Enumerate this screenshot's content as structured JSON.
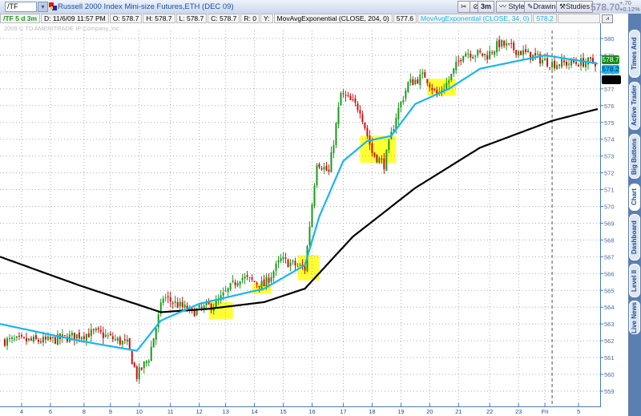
{
  "header": {
    "symbol": "/TF",
    "title": "Russell 2000 Index Mini-size Futures,ETH (DEC 09)",
    "last": "578.70",
    "change": "+.70",
    "change_pct": "+0.12%",
    "toolbar": {
      "aggregation": "3m",
      "style": "Style",
      "drawings": "Drawings",
      "studies": "Studies"
    }
  },
  "info_bar": {
    "symbol_period": "/TF 5 d 3m",
    "date": "D: 11/6/09 11:57 PM",
    "open": "O: 578.7",
    "high": "H: 578.7",
    "low": "L: 578.7",
    "close": "C: 578.7",
    "range": "R: 0",
    "y": "Y:",
    "study1": "MovAvgExponential (CLOSE, 204, 0)",
    "study1_val": "577.6",
    "study2": "MovAvgExponential (CLOSE, 34, 0)",
    "study2_val": "578.2"
  },
  "copyright": "2009 © TD AMERITRADE IP Company, Inc.",
  "price_tags": {
    "last": "578.7",
    "ema34": "578.2"
  },
  "colors": {
    "up": "#1a9a1a",
    "down": "#d01010",
    "ema34": "#19b5f0",
    "ema204": "#000000",
    "highlight": "#ffff33"
  },
  "side_tabs": [
    "Times And Sales",
    "Active Trader",
    "Big Buttons",
    "Chart",
    "Dashboard",
    "Level II",
    "Live News"
  ],
  "chart_data": {
    "type": "candlestick",
    "y_ticks": [
      559,
      560,
      561,
      562,
      563,
      564,
      565,
      566,
      567,
      568,
      569,
      570,
      571,
      572,
      573,
      574,
      575,
      576,
      577,
      578,
      579,
      580
    ],
    "ylim": [
      558.2,
      580.5
    ],
    "xlim": [
      0,
      250
    ],
    "x_ticks": [
      {
        "label": "4",
        "x": 9
      },
      {
        "label": "6",
        "x": 21
      },
      {
        "label": "8",
        "x": 35
      },
      {
        "label": "9",
        "x": 46
      },
      {
        "label": "10",
        "x": 58
      },
      {
        "label": "11",
        "x": 71
      },
      {
        "label": "12",
        "x": 83
      },
      {
        "label": "13",
        "x": 94
      },
      {
        "label": "14",
        "x": 106
      },
      {
        "label": "15",
        "x": 118
      },
      {
        "label": "16",
        "x": 130
      },
      {
        "label": "17",
        "x": 143
      },
      {
        "label": "18",
        "x": 155
      },
      {
        "label": "19",
        "x": 167
      },
      {
        "label": "20",
        "x": 179
      },
      {
        "label": "21",
        "x": 191
      },
      {
        "label": "22",
        "x": 204
      },
      {
        "label": "23",
        "x": 216
      },
      {
        "label": "Fri",
        "x": 227
      },
      {
        "label": "5",
        "x": 241
      }
    ],
    "session_break_x": 230,
    "price_path": [
      [
        2,
        562.0
      ],
      [
        20,
        562.0
      ],
      [
        40,
        562.5
      ],
      [
        53,
        561.8
      ],
      [
        57,
        559.9
      ],
      [
        62,
        561
      ],
      [
        68,
        564.6
      ],
      [
        80,
        563.7
      ],
      [
        90,
        564.2
      ],
      [
        100,
        565.8
      ],
      [
        110,
        565.3
      ],
      [
        117,
        566.8
      ],
      [
        127,
        566.3
      ],
      [
        129,
        568.9
      ],
      [
        132,
        572.7
      ],
      [
        137,
        572
      ],
      [
        142,
        576.7
      ],
      [
        150,
        575.8
      ],
      [
        155,
        573.2
      ],
      [
        160,
        572.5
      ],
      [
        165,
        575.4
      ],
      [
        170,
        577.3
      ],
      [
        177,
        577.8
      ],
      [
        182,
        576.6
      ],
      [
        187,
        577.5
      ],
      [
        193,
        579.2
      ],
      [
        203,
        579
      ],
      [
        208,
        579.7
      ],
      [
        217,
        579.2
      ],
      [
        230,
        578.5
      ],
      [
        248,
        578.6
      ]
    ],
    "ema34": [
      [
        0,
        563.0
      ],
      [
        33,
        562.0
      ],
      [
        57,
        561.4
      ],
      [
        67,
        563.2
      ],
      [
        83,
        564.2
      ],
      [
        110,
        565.1
      ],
      [
        127,
        566.5
      ],
      [
        133,
        569.4
      ],
      [
        143,
        572.7
      ],
      [
        153,
        573.9
      ],
      [
        163,
        574.2
      ],
      [
        173,
        576.1
      ],
      [
        187,
        577
      ],
      [
        200,
        578.2
      ],
      [
        227,
        579
      ],
      [
        249,
        578.5
      ]
    ],
    "ema204": [
      [
        0,
        567.0
      ],
      [
        33,
        565.3
      ],
      [
        67,
        563.7
      ],
      [
        87,
        563.9
      ],
      [
        110,
        564.3
      ],
      [
        127,
        565.1
      ],
      [
        147,
        568.2
      ],
      [
        173,
        571.1
      ],
      [
        200,
        573.5
      ],
      [
        230,
        575.1
      ],
      [
        249,
        575.8
      ]
    ],
    "highlights": [
      [
        87,
        97,
        564.3,
        563.3
      ],
      [
        105,
        113,
        565.4,
        564.8
      ],
      [
        124,
        133,
        567.1,
        565.6
      ],
      [
        150,
        165,
        574.2,
        572.6
      ],
      [
        178,
        190,
        577.6,
        576.6
      ]
    ]
  }
}
